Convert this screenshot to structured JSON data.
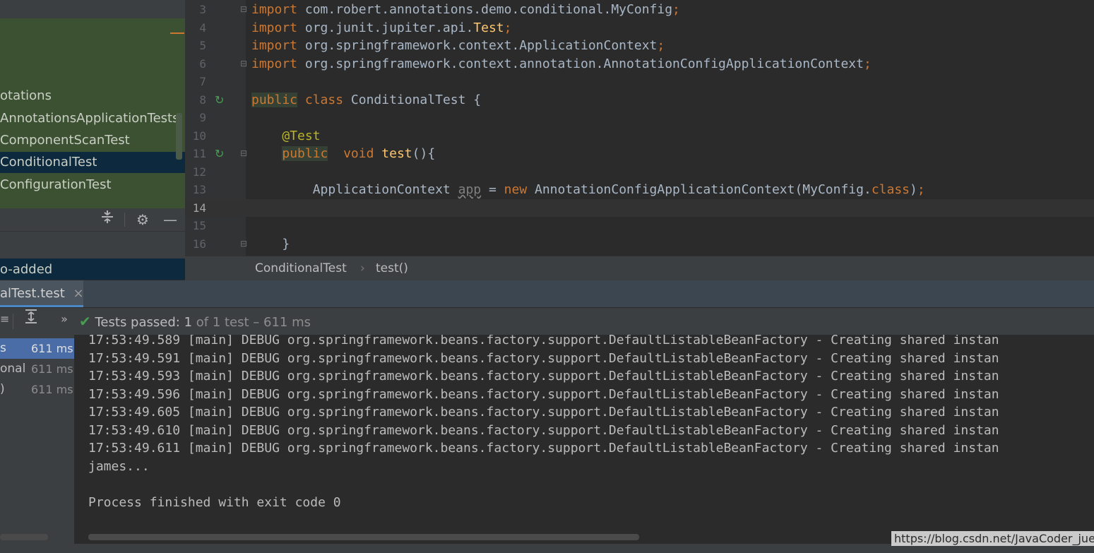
{
  "project_tree": {
    "items": [
      {
        "label": "otations",
        "selected": false
      },
      {
        "label": "AnnotationsApplicationTests",
        "selected": false
      },
      {
        "label": "ComponentScanTest",
        "selected": false
      },
      {
        "label": "ConditionalTest",
        "selected": true
      },
      {
        "label": "ConfigurationTest",
        "selected": false
      }
    ],
    "vcs_label": "o-added"
  },
  "editor": {
    "lines": [
      {
        "n": "3",
        "text": "import com.robert.annotations.demo.conditional.MyConfig;"
      },
      {
        "n": "4",
        "text": "import org.junit.jupiter.api.Test;"
      },
      {
        "n": "5",
        "text": "import org.springframework.context.ApplicationContext;"
      },
      {
        "n": "6",
        "text": "import org.springframework.context.annotation.AnnotationConfigApplicationContext;"
      },
      {
        "n": "7",
        "text": ""
      },
      {
        "n": "8",
        "text": "public class ConditionalTest {"
      },
      {
        "n": "9",
        "text": ""
      },
      {
        "n": "10",
        "text": "@Test"
      },
      {
        "n": "11",
        "text": "public  void test(){"
      },
      {
        "n": "12",
        "text": ""
      },
      {
        "n": "13",
        "text": "ApplicationContext app = new AnnotationConfigApplicationContext(MyConfig.class);"
      },
      {
        "n": "14",
        "text": ""
      },
      {
        "n": "15",
        "text": ""
      },
      {
        "n": "16",
        "text": "}"
      }
    ],
    "breadcrumb": [
      "ConditionalTest",
      "test()"
    ]
  },
  "run": {
    "tab_label": "alTest.test",
    "status_passed": "Tests passed:",
    "status_count": "1",
    "status_of": "of 1 test",
    "status_time": "– 611 ms",
    "tree": [
      {
        "label": "s",
        "time": "611 ms",
        "selected": true
      },
      {
        "label": "onal",
        "time": "611 ms",
        "selected": false
      },
      {
        "label": ")",
        "time": "611 ms",
        "selected": false
      }
    ],
    "console": [
      "17:53:49.589 [main] DEBUG org.springframework.beans.factory.support.DefaultListableBeanFactory - Creating shared instan",
      "17:53:49.591 [main] DEBUG org.springframework.beans.factory.support.DefaultListableBeanFactory - Creating shared instan",
      "17:53:49.593 [main] DEBUG org.springframework.beans.factory.support.DefaultListableBeanFactory - Creating shared instan",
      "17:53:49.596 [main] DEBUG org.springframework.beans.factory.support.DefaultListableBeanFactory - Creating shared instan",
      "17:53:49.605 [main] DEBUG org.springframework.beans.factory.support.DefaultListableBeanFactory - Creating shared instan",
      "17:53:49.610 [main] DEBUG org.springframework.beans.factory.support.DefaultListableBeanFactory - Creating shared instan",
      "17:53:49.611 [main] DEBUG org.springframework.beans.factory.support.DefaultListableBeanFactory - Creating shared instan",
      "james...",
      "",
      "Process finished with exit code 0"
    ]
  },
  "watermark": "https://blog.csdn.net/JavaCoder_juejue",
  "icons": {
    "collapse": "collapse-all-icon",
    "settings": "gear-icon",
    "hide": "minimize-icon",
    "run": "run-gutter-icon",
    "pass": "check-icon"
  }
}
